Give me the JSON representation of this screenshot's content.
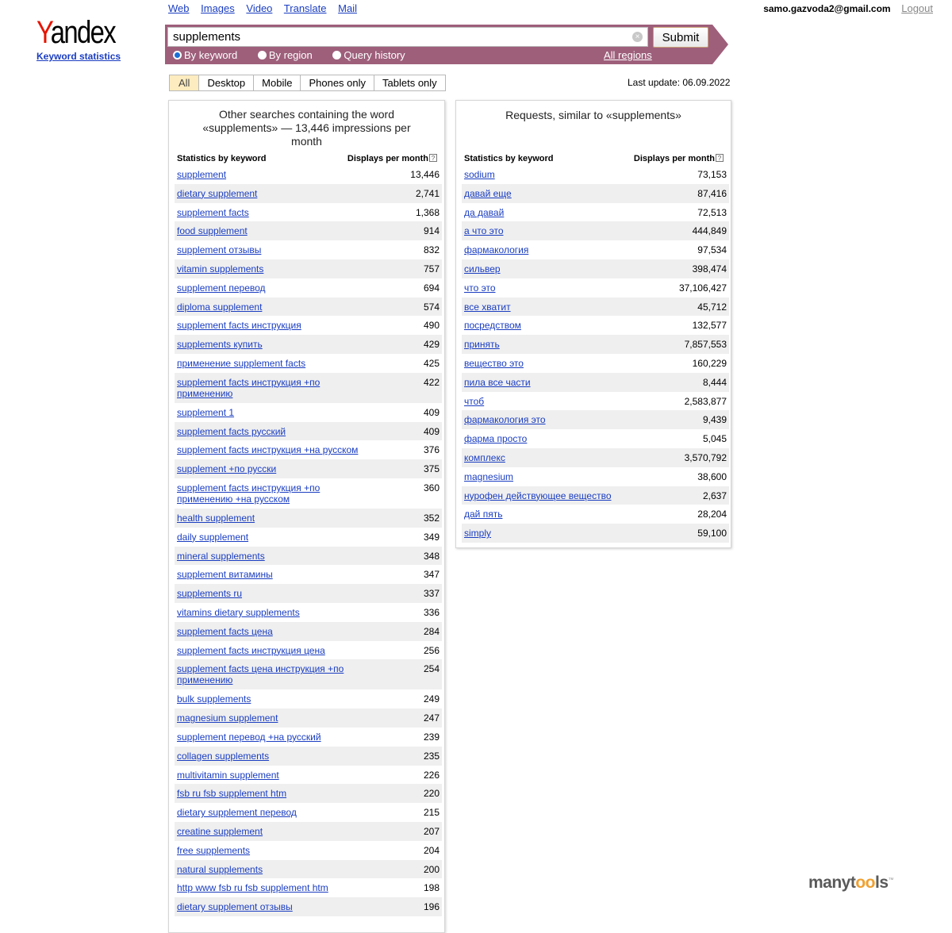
{
  "logo": {
    "word": "Yandex",
    "first_letter": "Y",
    "rest": "andex",
    "subtitle": "Keyword statistics"
  },
  "nav": [
    "Web",
    "Images",
    "Video",
    "Translate",
    "Mail"
  ],
  "user": {
    "email": "samo.gazvoda2@gmail.com",
    "logout": "Logout"
  },
  "search": {
    "value": "supplements",
    "submit_label": "Submit",
    "clear_icon": "close-circle-icon",
    "modes": [
      {
        "label": "By keyword",
        "selected": true
      },
      {
        "label": "By region",
        "selected": false
      },
      {
        "label": "Query history",
        "selected": false
      }
    ],
    "regions_link": "All regions"
  },
  "tabs": [
    {
      "label": "All",
      "active": true
    },
    {
      "label": "Desktop",
      "active": false
    },
    {
      "label": "Mobile",
      "active": false
    },
    {
      "label": "Phones only",
      "active": false
    },
    {
      "label": "Tablets only",
      "active": false
    }
  ],
  "last_update": "Last update: 06.09.2022",
  "left_panel": {
    "title": "Other searches containing the word «supplements» — 13,446 impressions per month",
    "col_keyword": "Statistics by keyword",
    "col_displays": "Displays per month",
    "help_icon": "?",
    "rows": [
      [
        "supplement",
        "13,446"
      ],
      [
        "dietary supplement",
        "2,741"
      ],
      [
        "supplement facts",
        "1,368"
      ],
      [
        "food supplement",
        "914"
      ],
      [
        "supplement отзывы",
        "832"
      ],
      [
        "vitamin supplements",
        "757"
      ],
      [
        "supplement перевод",
        "694"
      ],
      [
        "diploma supplement",
        "574"
      ],
      [
        "supplement facts инструкция",
        "490"
      ],
      [
        "supplements купить",
        "429"
      ],
      [
        "применение supplement facts",
        "425"
      ],
      [
        "supplement facts инструкция +по применению",
        "422"
      ],
      [
        "supplement 1",
        "409"
      ],
      [
        "supplement facts русский",
        "409"
      ],
      [
        "supplement facts инструкция +на русском",
        "376"
      ],
      [
        "supplement +по русски",
        "375"
      ],
      [
        "supplement facts инструкция +по применению +на русском",
        "360"
      ],
      [
        "health supplement",
        "352"
      ],
      [
        "daily supplement",
        "349"
      ],
      [
        "mineral supplements",
        "348"
      ],
      [
        "supplement витамины",
        "347"
      ],
      [
        "supplements ru",
        "337"
      ],
      [
        "vitamins dietary supplements",
        "336"
      ],
      [
        "supplement facts цена",
        "284"
      ],
      [
        "supplement facts инструкция цена",
        "256"
      ],
      [
        "supplement facts цена инструкция +по применению",
        "254"
      ],
      [
        "bulk supplements",
        "249"
      ],
      [
        "magnesium supplement",
        "247"
      ],
      [
        "supplement перевод +на русский",
        "239"
      ],
      [
        "collagen supplements",
        "235"
      ],
      [
        "multivitamin supplement",
        "226"
      ],
      [
        "fsb ru fsb supplement htm",
        "220"
      ],
      [
        "dietary supplement перевод",
        "215"
      ],
      [
        "creatine supplement",
        "207"
      ],
      [
        "free supplements",
        "204"
      ],
      [
        "natural supplements",
        "200"
      ],
      [
        "http www fsb ru fsb supplement htm",
        "198"
      ],
      [
        "dietary supplement отзывы",
        "196"
      ]
    ]
  },
  "right_panel": {
    "title": "Requests, similar to «supplements»",
    "col_keyword": "Statistics by keyword",
    "col_displays": "Displays per month",
    "help_icon": "?",
    "rows": [
      [
        "sodium",
        "73,153"
      ],
      [
        "давай еще",
        "87,416"
      ],
      [
        "да давай",
        "72,513"
      ],
      [
        "а что это",
        "444,849"
      ],
      [
        "фармакология",
        "97,534"
      ],
      [
        "сильвер",
        "398,474"
      ],
      [
        "что это",
        "37,106,427"
      ],
      [
        "все хватит",
        "45,712"
      ],
      [
        "посредством",
        "132,577"
      ],
      [
        "принять",
        "7,857,553"
      ],
      [
        "вещество это",
        "160,229"
      ],
      [
        "пила все части",
        "8,444"
      ],
      [
        "чтоб",
        "2,583,877"
      ],
      [
        "фармакология это",
        "9,439"
      ],
      [
        "фарма просто",
        "5,045"
      ],
      [
        "комплекс",
        "3,570,792"
      ],
      [
        "magnesium",
        "38,600"
      ],
      [
        "нурофен действующее вещество",
        "2,637"
      ],
      [
        "дай пять",
        "28,204"
      ],
      [
        "simply",
        "59,100"
      ]
    ]
  },
  "watermark": {
    "part1": "manyt",
    "part2": "oo",
    "part3": "ls",
    "tm": "™"
  }
}
